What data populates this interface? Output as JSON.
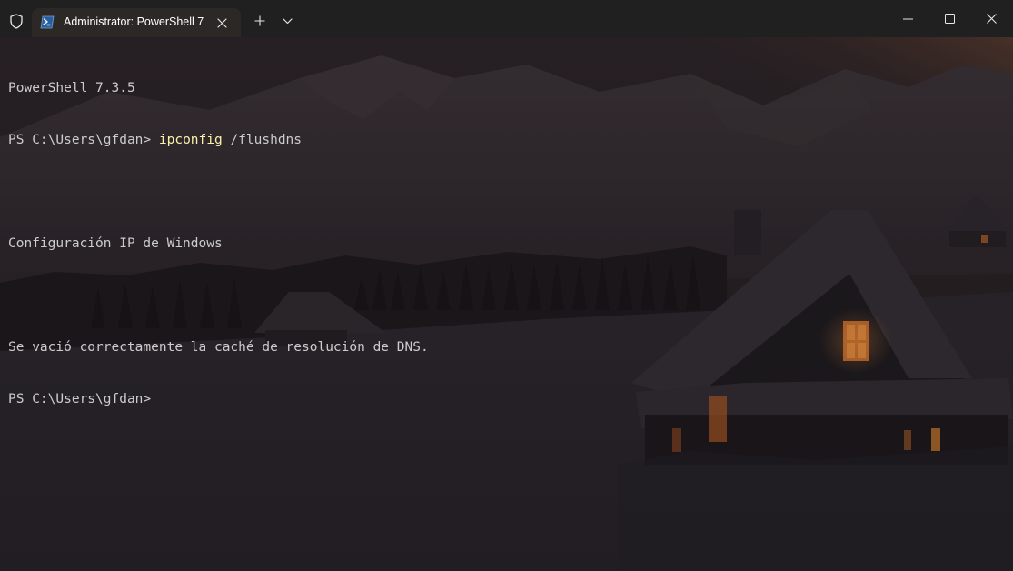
{
  "window": {
    "tab_title": "Administrator: PowerShell 7"
  },
  "icons": {
    "shield": "shield-icon",
    "tab": "powershell-icon",
    "tab_close": "close-icon",
    "new_tab": "plus-icon",
    "dropdown": "chevron-down-icon",
    "minimize": "minimize-icon",
    "maximize": "maximize-icon",
    "close": "close-icon"
  },
  "colors": {
    "titlebar": "#202020",
    "tab": "#2c2826",
    "text": "#cccccc",
    "command": "#f9f1a5"
  },
  "terminal": {
    "version_line": "PowerShell 7.3.5",
    "prompt1": "PS C:\\Users\\gfdan> ",
    "command": "ipconfig",
    "argument": " /flushdns",
    "output_header": "Configuración IP de Windows",
    "output_result": "Se vació correctamente la caché de resolución de DNS.",
    "prompt2": "PS C:\\Users\\gfdan>"
  }
}
